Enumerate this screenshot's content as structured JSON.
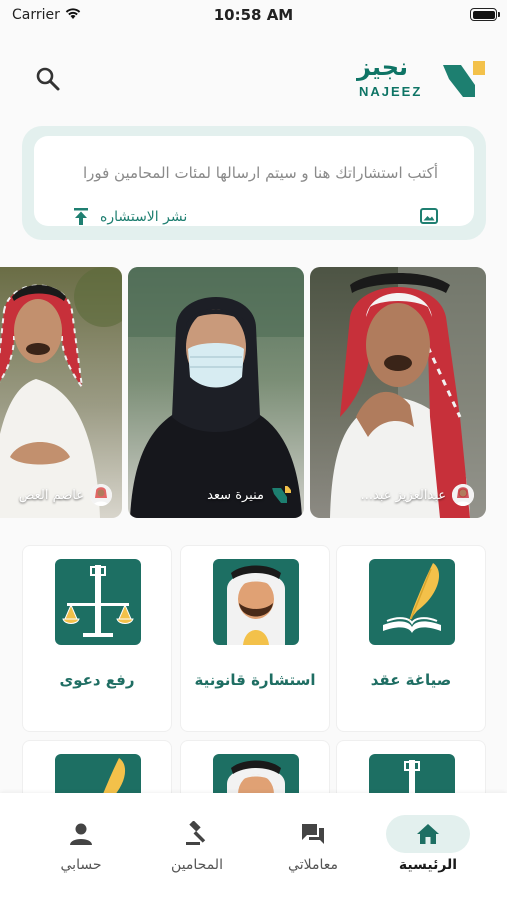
{
  "status_bar": {
    "carrier": "Carrier",
    "time": "10:58 AM"
  },
  "header": {
    "logo_ar": "نجيز",
    "logo_en": "NAJEEZ"
  },
  "compose": {
    "placeholder": "أكتب استشاراتك هنا و سيتم ارسالها لمئات المحامين فورا",
    "publish_label": "نشر الاستشاره"
  },
  "lawyers": [
    {
      "name": "عبدالعزيز عبد..."
    },
    {
      "name": "منيرة سعد"
    },
    {
      "name": "عاصم العص"
    }
  ],
  "services": [
    {
      "label": "صياغة عقد",
      "icon": "quill-book-icon"
    },
    {
      "label": "استشارة قانونية",
      "icon": "lawyer-avatar-icon"
    },
    {
      "label": "رفع دعوى",
      "icon": "scales-icon"
    },
    {
      "label": "",
      "icon": "quill-book-icon"
    },
    {
      "label": "",
      "icon": "lawyer-avatar-icon"
    },
    {
      "label": "",
      "icon": "scales-icon"
    }
  ],
  "nav": {
    "home": "الرئيسية",
    "transactions": "معاملاتي",
    "lawyers": "المحامين",
    "account": "حسابي"
  },
  "colors": {
    "brand": "#1d6f63",
    "brand_light": "#e3f0ee",
    "accent": "#f3c14a"
  }
}
